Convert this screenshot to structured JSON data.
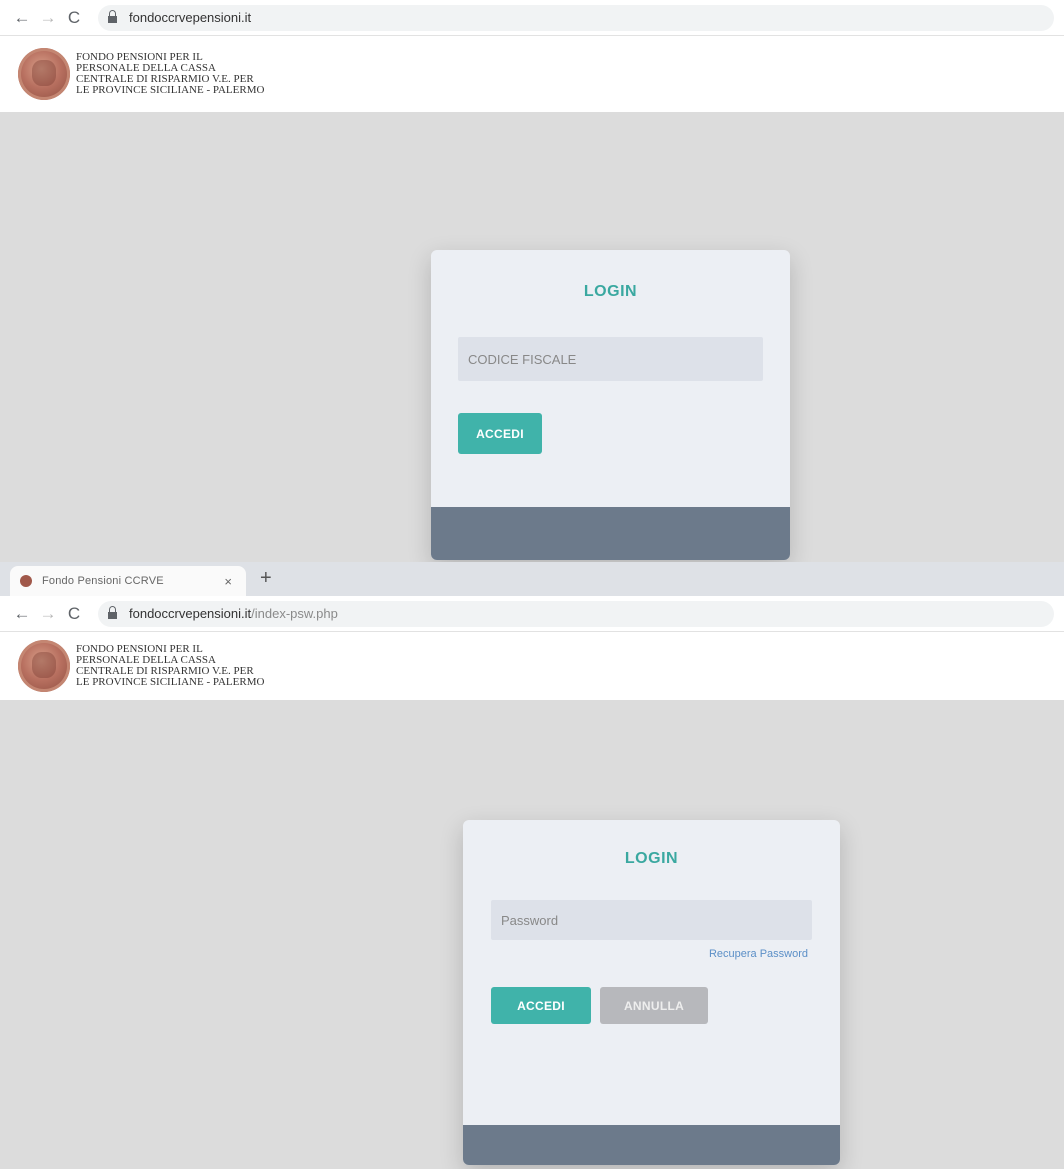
{
  "colors": {
    "accent": "#40b3aa",
    "title": "#3aa8a0",
    "footer": "#6c7a8b",
    "background": "#dcdcdc",
    "link": "#5b8fc7"
  },
  "org_lines": [
    "FONDO PENSIONI  PER IL",
    "PERSONALE DELLA CASSA",
    "CENTRALE DI RISPARMIO V.E. PER",
    "LE PROVINCE SICILIANE - PALERMO"
  ],
  "screen1": {
    "url": "fondoccrvepensioni.it",
    "login": {
      "title": "LOGIN",
      "codice_placeholder": "CODICE FISCALE",
      "accedi_label": "ACCEDI"
    }
  },
  "screen2": {
    "tab_title": "Fondo Pensioni CCRVE",
    "tab_close": "×",
    "new_tab": "+",
    "url_host": "fondoccrvepensioni.it",
    "url_path": "/index-psw.php",
    "login": {
      "title": "LOGIN",
      "password_placeholder": "Password",
      "recover_label": "Recupera Password",
      "accedi_label": "ACCEDI",
      "annulla_label": "ANNULLA"
    }
  }
}
